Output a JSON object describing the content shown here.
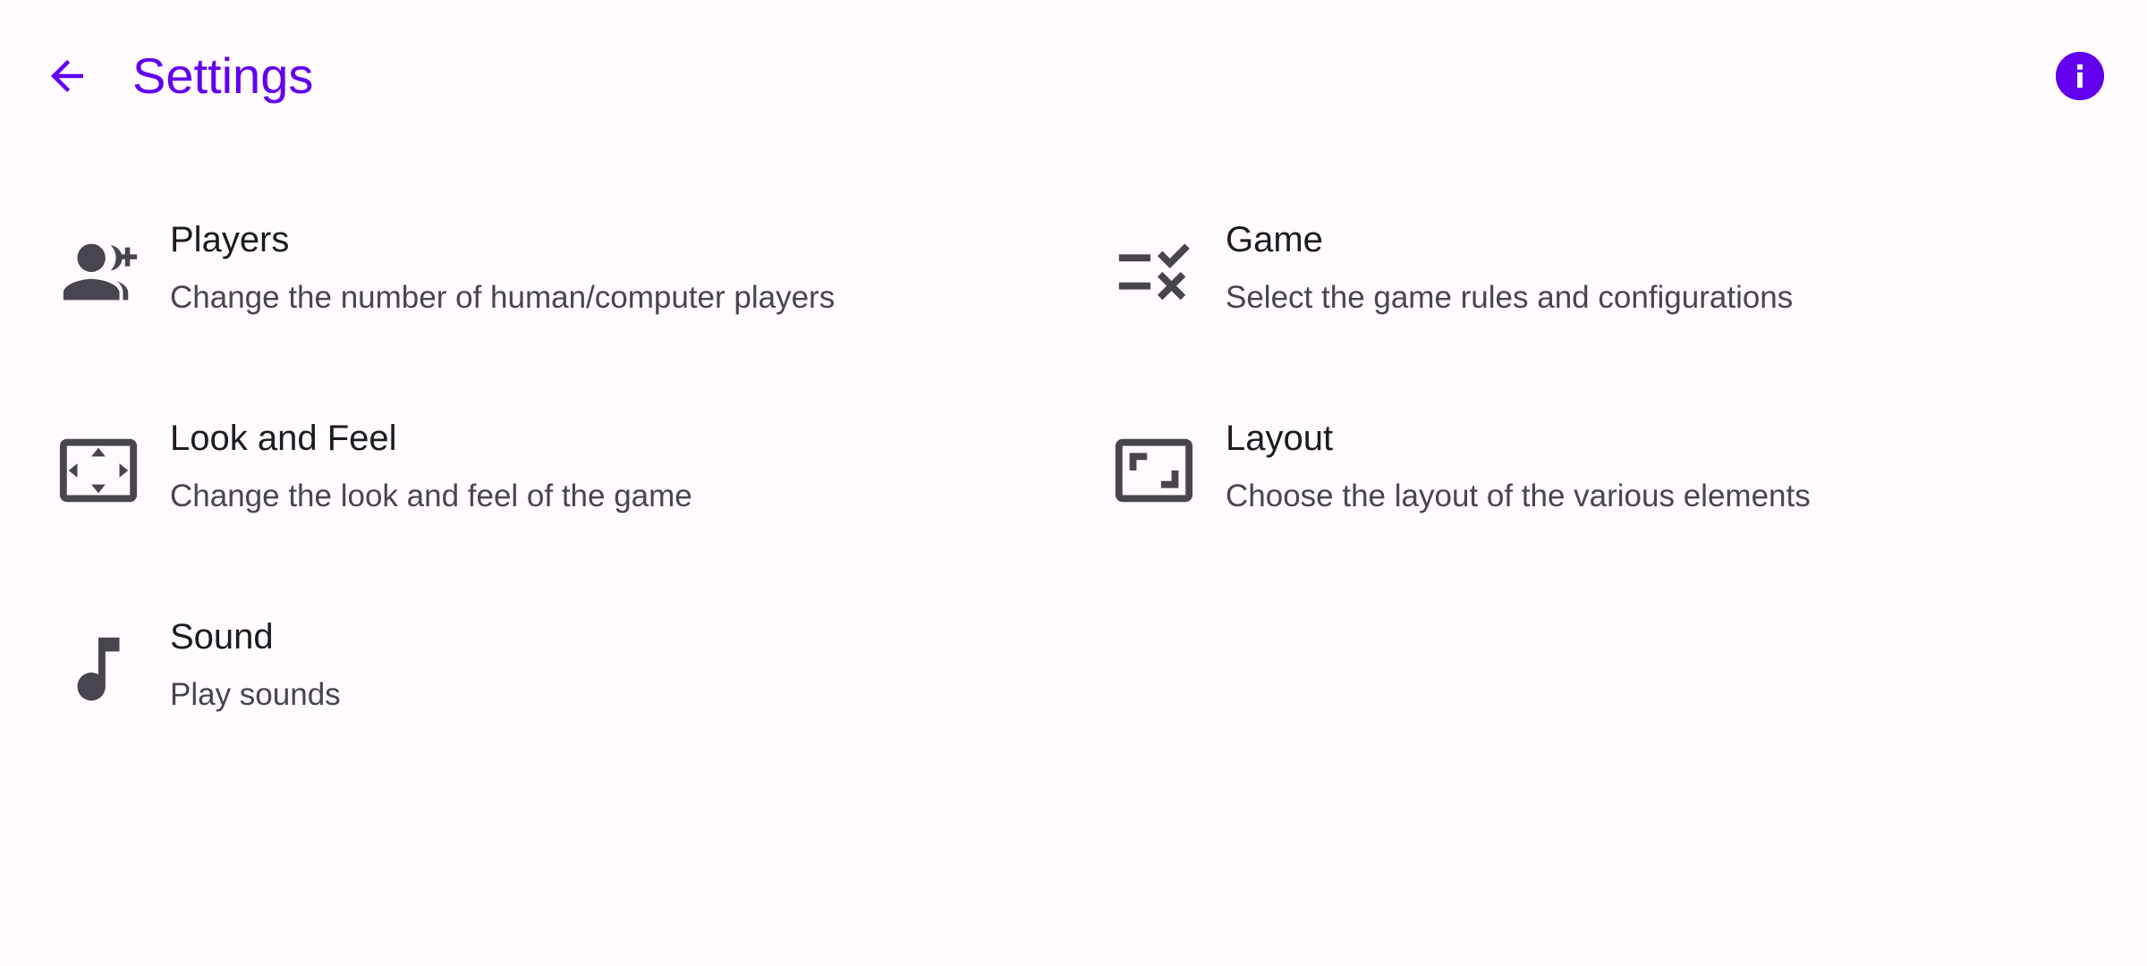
{
  "app_bar": {
    "title": "Settings",
    "back_icon": "arrow-back-icon",
    "info_icon": "info-icon"
  },
  "settings": [
    {
      "id": "players",
      "icon": "group-add-icon",
      "title": "Players",
      "summary": "Change the number of human/computer players"
    },
    {
      "id": "game",
      "icon": "rule-icon",
      "title": "Game",
      "summary": "Select the game rules and configurations"
    },
    {
      "id": "look-and-feel",
      "icon": "settings-overscan-icon",
      "title": "Look and Feel",
      "summary": "Change the look and feel of the game"
    },
    {
      "id": "layout",
      "icon": "crop-free-icon",
      "title": "Layout",
      "summary": "Choose the layout of the various elements"
    },
    {
      "id": "sound",
      "icon": "music-note-icon",
      "title": "Sound",
      "summary": "Play sounds"
    }
  ],
  "colors": {
    "accent": "#6200ee",
    "background": "#fffbfe",
    "title_text": "#1c1b1f",
    "summary_text": "#49454f",
    "icon": "#49454f"
  }
}
